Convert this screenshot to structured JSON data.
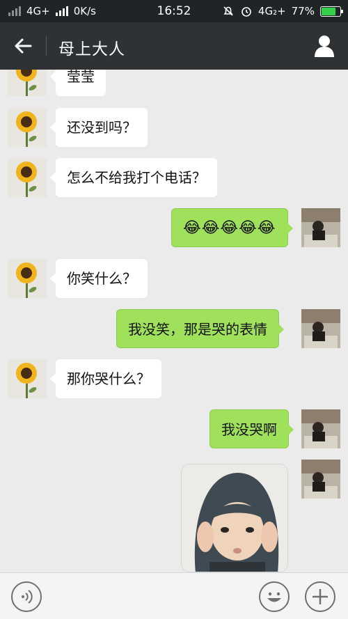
{
  "status_bar": {
    "network_left": "4G+",
    "speed": "0K/s",
    "time": "16:52",
    "network_right": "4G₂+",
    "battery": "77%",
    "battery_level": 0.77,
    "icons": [
      "signal-icon",
      "mute-icon",
      "alarm-icon",
      "battery-icon"
    ]
  },
  "header": {
    "title": "母上大人",
    "back_icon": "arrow-left-icon",
    "profile_icon": "person-icon"
  },
  "messages": [
    {
      "sender": "contact",
      "text": "莹莹"
    },
    {
      "sender": "contact",
      "text": "还没到吗？"
    },
    {
      "sender": "contact",
      "text": "怎么不给我打个电话？"
    },
    {
      "sender": "me",
      "text": "😂😂😂😂😂"
    },
    {
      "sender": "contact",
      "text": "你笑什么？"
    },
    {
      "sender": "me",
      "text": "我没笑，那是哭的表情"
    },
    {
      "sender": "contact",
      "text": "那你哭什么？"
    },
    {
      "sender": "me",
      "text": "我没哭啊"
    },
    {
      "sender": "me",
      "type": "sticker",
      "sticker": "crying-child-sticker"
    }
  ],
  "input_bar": {
    "icons": [
      "voice-icon",
      "emoji-icon",
      "plus-icon"
    ]
  },
  "colors": {
    "header_bg": "#2e3235",
    "chat_bg": "#ebebeb",
    "bubble_out": "#9fe15b",
    "bubble_in": "#ffffff"
  }
}
